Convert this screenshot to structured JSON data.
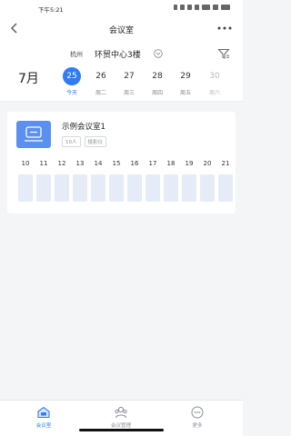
{
  "status_bar": {
    "time": "下午5:21"
  },
  "header": {
    "title": "会议室"
  },
  "location": {
    "city": "杭州",
    "building": "环贸中心3楼"
  },
  "calendar": {
    "month": "7月",
    "days": [
      {
        "num": "25",
        "label": "今天"
      },
      {
        "num": "26",
        "label": "周二"
      },
      {
        "num": "27",
        "label": "周三"
      },
      {
        "num": "28",
        "label": "周四"
      },
      {
        "num": "29",
        "label": "周五"
      },
      {
        "num": "30",
        "label": "周六"
      }
    ]
  },
  "room": {
    "name": "示例会议室1",
    "tags": [
      "10人",
      "投影仪"
    ],
    "hours": [
      "10",
      "11",
      "12",
      "13",
      "14",
      "15",
      "16",
      "17",
      "18",
      "19",
      "20",
      "21"
    ]
  },
  "bottom_nav": {
    "items": [
      {
        "label": "会议室"
      },
      {
        "label": "会议管理"
      },
      {
        "label": "更多"
      }
    ]
  },
  "colors": {
    "accent": "#2f7cf6",
    "room_icon": "#5b8ff0",
    "slot": "#e5ecf8"
  }
}
